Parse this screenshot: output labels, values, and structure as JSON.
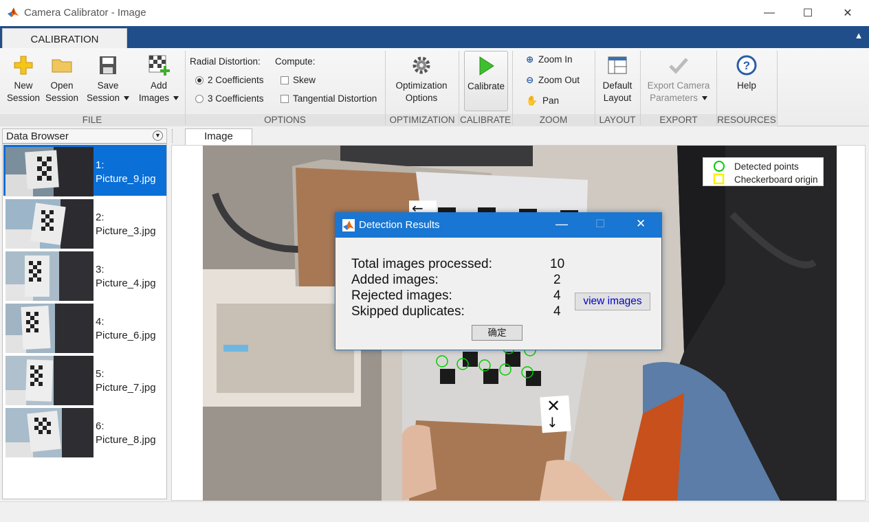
{
  "window": {
    "title": "Camera Calibrator - Image",
    "minimize": "—",
    "maximize": "☐",
    "close": "✕"
  },
  "ribbon": {
    "tab": "CALIBRATION",
    "file": {
      "group_label": "FILE",
      "new_session": [
        "New",
        "Session"
      ],
      "open_session": [
        "Open",
        "Session"
      ],
      "save_session": [
        "Save",
        "Session"
      ],
      "add_images": [
        "Add",
        "Images"
      ]
    },
    "options": {
      "group_label": "OPTIONS",
      "radial_label": "Radial Distortion:",
      "compute_label": "Compute:",
      "two_coeff": "2 Coefficients",
      "three_coeff": "3 Coefficients",
      "skew": "Skew",
      "tangential": "Tangential Distortion",
      "selected_radial": "2 Coefficients"
    },
    "optimization": {
      "group_label": "OPTIMIZATION",
      "button": [
        "Optimization",
        "Options"
      ]
    },
    "calibrate": {
      "group_label": "CALIBRATE",
      "button": "Calibrate"
    },
    "zoom": {
      "group_label": "ZOOM",
      "zoom_in": "Zoom In",
      "zoom_out": "Zoom Out",
      "pan": "Pan"
    },
    "layout": {
      "group_label": "LAYOUT",
      "button": [
        "Default",
        "Layout"
      ]
    },
    "export": {
      "group_label": "EXPORT",
      "button": [
        "Export Camera",
        "Parameters"
      ]
    },
    "resources": {
      "group_label": "RESOURCES",
      "button": "Help"
    }
  },
  "browser": {
    "title": "Data Browser",
    "items": [
      {
        "num": "1:",
        "name": "Picture_9.jpg",
        "selected": true
      },
      {
        "num": "2:",
        "name": "Picture_3.jpg",
        "selected": false
      },
      {
        "num": "3:",
        "name": "Picture_4.jpg",
        "selected": false
      },
      {
        "num": "4:",
        "name": "Picture_6.jpg",
        "selected": false
      },
      {
        "num": "5:",
        "name": "Picture_7.jpg",
        "selected": false
      },
      {
        "num": "6:",
        "name": "Picture_8.jpg",
        "selected": false
      }
    ]
  },
  "image_tab": "Image",
  "legend": {
    "detected": "Detected points",
    "origin": "Checkerboard origin",
    "detected_color": "#00cc00",
    "origin_color": "#ffee00"
  },
  "dialog": {
    "title": "Detection Results",
    "rows": [
      {
        "label": "Total images processed:",
        "value": "10"
      },
      {
        "label": "Added images:",
        "value": "2"
      },
      {
        "label": "Rejected images:",
        "value": "4"
      },
      {
        "label": "Skipped duplicates:",
        "value": "4"
      }
    ],
    "view_button": "view images",
    "ok_button": "确定"
  },
  "colors": {
    "accent": "#1976d2",
    "selection": "#0a6fd6",
    "ribbon_tabstrip": "#1f4e8a"
  }
}
